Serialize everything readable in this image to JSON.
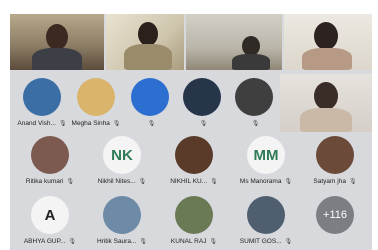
{
  "video_feeds": [
    {
      "id": "v1",
      "kind": "webcam"
    },
    {
      "id": "v2",
      "kind": "webcam"
    },
    {
      "id": "v3",
      "kind": "webcam"
    },
    {
      "id": "v4",
      "kind": "webcam"
    },
    {
      "id": "v5",
      "kind": "webcam"
    }
  ],
  "participants": [
    {
      "name": "Anand Vish...",
      "avatar": "photo",
      "color": "#3a6ea5"
    },
    {
      "name": "Megha Sinha",
      "avatar": "photo",
      "color": "#d9b46a"
    },
    {
      "name": "",
      "avatar": "photo",
      "color": "#2c6fd1"
    },
    {
      "name": "",
      "avatar": "photo",
      "color": "#27354a"
    },
    {
      "name": "",
      "avatar": "photo",
      "color": "#3f3f3f"
    },
    {
      "name": "Ritika kumari",
      "avatar": "photo",
      "color": "#7d5a4f"
    },
    {
      "name": "Nikhil Nites...",
      "avatar": "initials",
      "initials": "NK"
    },
    {
      "name": "NIKHIL KU...",
      "avatar": "photo",
      "color": "#5a3b2a"
    },
    {
      "name": "Ms Manorama",
      "avatar": "initials",
      "initials": "MM"
    },
    {
      "name": "Satyam jha",
      "avatar": "photo",
      "color": "#6b4a3a"
    },
    {
      "name": "ABHYA GUP...",
      "avatar": "initials",
      "initials": "A"
    },
    {
      "name": "Hritik Saura...",
      "avatar": "photo",
      "color": "#6d8aa6"
    },
    {
      "name": "KUNAL RAJ",
      "avatar": "photo",
      "color": "#6a7a55"
    },
    {
      "name": "SUMIT GOS...",
      "avatar": "photo",
      "color": "#4f5f70"
    },
    {
      "name": "",
      "avatar": "more",
      "more": "+116"
    }
  ],
  "icons": {
    "muted": "mic-muted-icon"
  }
}
